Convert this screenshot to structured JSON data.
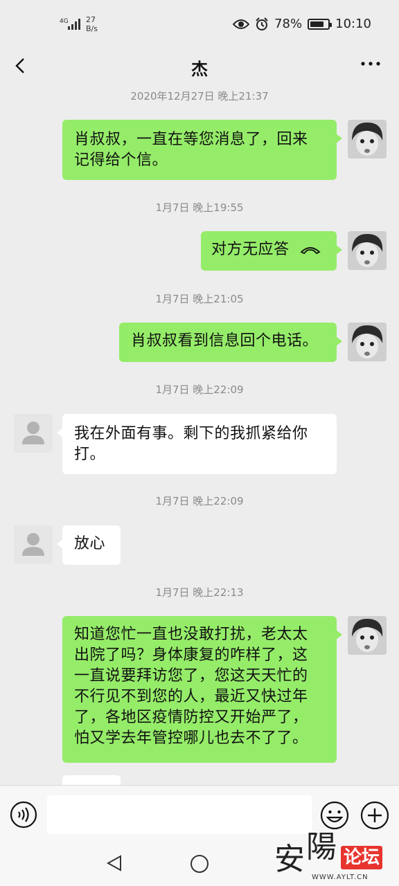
{
  "status_bar": {
    "network": "4G",
    "speed_value": "27",
    "speed_unit": "B/s",
    "battery": "78%",
    "battery_level": 0.78,
    "time": "10:10"
  },
  "header": {
    "title": "杰",
    "more": "···"
  },
  "messages": [
    {
      "time": "2020年12月27日 晚上21:37",
      "side": "out",
      "text": "肖叔叔，一直在等您消息了，回来\n记得给个信。"
    },
    {
      "time": "1月7日 晚上19:55",
      "side": "out",
      "text": "对方无应答",
      "icon": "phone-hangup-icon"
    },
    {
      "time": "1月7日 晚上21:05",
      "side": "out",
      "text": "肖叔叔看到信息回个电话。"
    },
    {
      "time": "1月7日 晚上22:09",
      "side": "in",
      "text": "我在外面有事。剩下的我抓紧给你\n打。"
    },
    {
      "time": "1月7日 晚上22:09",
      "side": "in",
      "text": "放心"
    },
    {
      "time": "1月7日 晚上22:13",
      "side": "out",
      "text": "知道您忙一直也没敢打扰，老太太\n出院了吗？身体康复的咋样了，这\n一直说要拜访您了，您这天天忙的\n不行见不到您的人，最近又快过年\n了，各地区疫情防控又开始严了，\n怕又学去年管控哪儿也去不了了。"
    }
  ],
  "input_bar": {
    "voice_icon": "voice-icon",
    "emoji_icon": "emoji-icon",
    "plus_icon": "plus-icon"
  },
  "watermark": {
    "char1": "安",
    "char2": "陽",
    "badge": "论坛",
    "url": "WWW.AYLT.CN"
  }
}
